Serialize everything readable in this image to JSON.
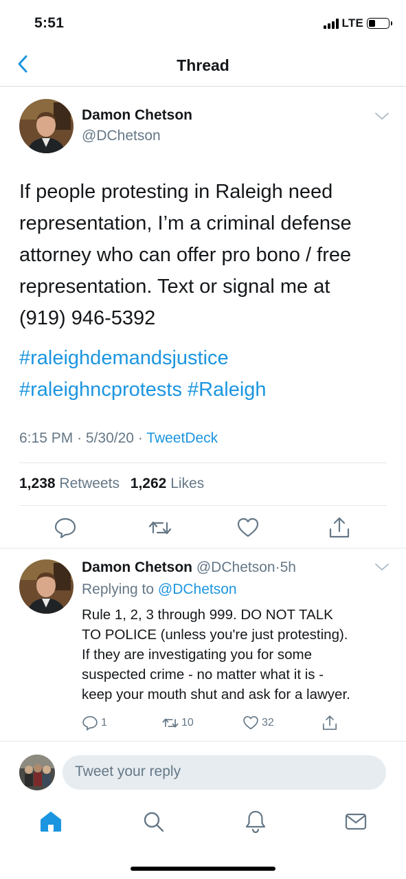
{
  "status_bar": {
    "time": "5:51",
    "network": "LTE",
    "battery_level": 0.35
  },
  "nav": {
    "title": "Thread",
    "back_icon": "chevron-left-icon"
  },
  "tweet": {
    "author_name": "Damon Chetson",
    "author_handle": "@DChetson",
    "text_lines": [
      "If people protesting in Raleigh need",
      "representation, I’m a criminal defense",
      "attorney who can offer pro bono / free",
      "representation.  Text or signal me at",
      "(919) 946-5392"
    ],
    "hashtags": [
      "#raleighdemandsjustice",
      "#raleighncprotests",
      "#Raleigh"
    ],
    "time": "6:15 PM",
    "date": "5/30/20",
    "separator": "·",
    "source": "TweetDeck",
    "retweets_count": "1,238",
    "retweets_label": "Retweets",
    "likes_count": "1,262",
    "likes_label": "Likes"
  },
  "reply": {
    "author_name": "Damon Chetson",
    "author_handle": "@DChetson",
    "separator": "·",
    "age": "5h",
    "replying_prefix": "Replying to",
    "replying_handle": "@DChetson",
    "text_lines": [
      "Rule 1, 2, 3 through 999.  DO NOT TALK",
      "TO POLICE (unless you're just protesting).",
      "If they are investigating you for some",
      "suspected crime - no matter what it is -",
      "keep your mouth shut and ask for a lawyer."
    ],
    "reply_count": "1",
    "retweet_count": "10",
    "like_count": "32"
  },
  "compose": {
    "placeholder": "Tweet your reply"
  },
  "tab_bar": {
    "items": [
      "home-icon",
      "search-icon",
      "notifications-icon",
      "messages-icon"
    ],
    "active": "home-icon"
  },
  "colors": {
    "accent": "#1b95e0",
    "secondary_text": "#657786",
    "primary_text": "#14171a",
    "divider": "#e1e8ed"
  }
}
